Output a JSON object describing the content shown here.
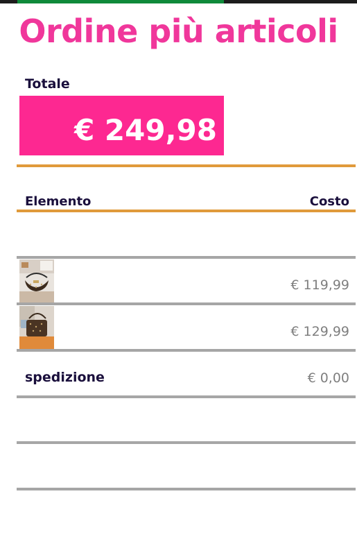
{
  "title": "Ordine più articoli",
  "total": {
    "label": "Totale",
    "value": "€ 249,98"
  },
  "table": {
    "headers": {
      "item": "Elemento",
      "cost": "Costo"
    },
    "rows": [
      {
        "image": "handbag-photo",
        "cost": "€ 119,99"
      },
      {
        "image": "handbag-photo",
        "cost": "€ 129,99"
      }
    ],
    "shipping": {
      "label": "spedizione",
      "cost": "€ 0,00"
    }
  },
  "colors": {
    "title": "#f0379b",
    "total_box": "#fd2891",
    "accent_rule": "#e09a3b",
    "grey_rule": "#a6a6a6"
  }
}
